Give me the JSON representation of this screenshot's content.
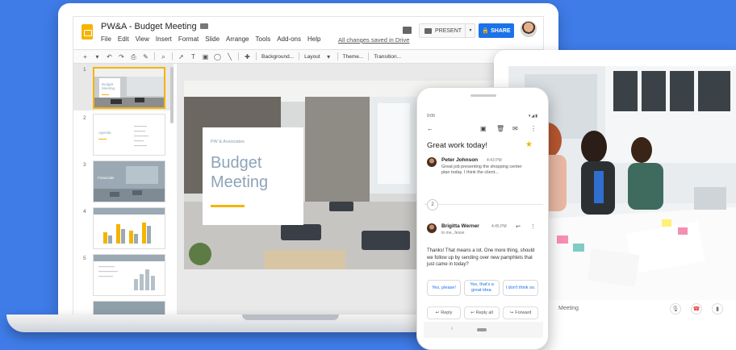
{
  "slides_app": {
    "doc_title": "PW&A - Budget Meeting",
    "menus": [
      "File",
      "Edit",
      "View",
      "Insert",
      "Format",
      "Slide",
      "Arrange",
      "Tools",
      "Add-ons",
      "Help"
    ],
    "saved_status": "All changes saved in Drive",
    "present_label": "PRESENT",
    "share_label": "SHARE",
    "toolbar": {
      "background_label": "Background...",
      "layout_label": "Layout",
      "theme_label": "Theme...",
      "transition_label": "Transition..."
    },
    "slide_numbers": [
      "1",
      "2",
      "3",
      "4",
      "5"
    ],
    "thumbnails": {
      "thumb1_title": "Budget Meeting",
      "thumb2_title": "Agenda",
      "thumb3_title": "Financials"
    },
    "main_slide": {
      "brand": "PW & Associates",
      "title": "Budget Meeting"
    }
  },
  "gmail_phone": {
    "status_time": "9:00",
    "subject": "Great work today!",
    "messages": [
      {
        "sender": "Peter Johnson",
        "time": "4:43 PM",
        "snippet": "Great job presenting the shopping center plan today. I think the client..."
      },
      {
        "sender": "Brigitta Werner",
        "time": "4:45 PM",
        "recipient": "to me, Jesse"
      }
    ],
    "collapsed_count": "2",
    "body": "Thanks! That means a lot. One more thing, should we follow up by sending over new pamphlets that just came in today?",
    "smart_replies": [
      "Yes, please!",
      "Yes, that's a great idea.",
      "I don't think so."
    ],
    "actions": {
      "reply": "Reply",
      "reply_all": "Reply all",
      "forward": "Forward"
    }
  },
  "meet_tablet": {
    "meeting_label": "Meeting"
  },
  "colors": {
    "background": "#3f7ce8",
    "share_blue": "#1a73e8",
    "slides_yellow": "#f4b400"
  }
}
